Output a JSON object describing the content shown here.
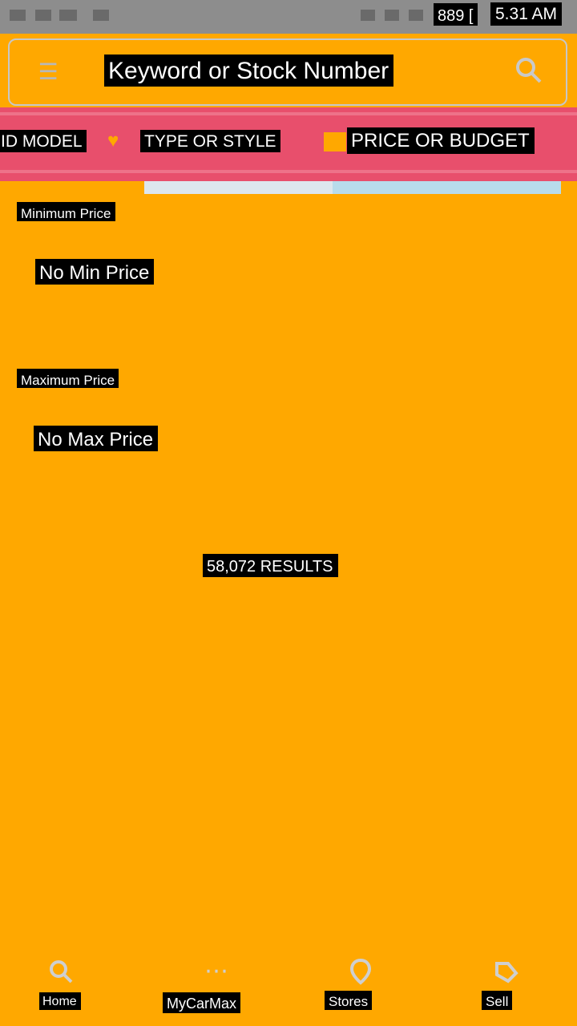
{
  "status_bar": {
    "count": "889 [",
    "time": "5.31 AM"
  },
  "search": {
    "placeholder": "Keyword or Stock Number"
  },
  "filters": {
    "tabs": [
      {
        "label": "ID MODEL"
      },
      {
        "label": "TYPE OR STYLE"
      },
      {
        "label": "PRICE OR BUDGET"
      }
    ],
    "selected": "PRICE OR BUDGET"
  },
  "price": {
    "min_label": "Minimum Price",
    "min_value": "No Min Price",
    "max_label": "Maximum Price",
    "max_value": "No Max Price"
  },
  "results": {
    "text": "58,072 RESULTS"
  },
  "bottom_nav": {
    "items": [
      {
        "label": "Home",
        "icon": "search-icon"
      },
      {
        "label": "MyCarMax",
        "icon": "car-icon"
      },
      {
        "label": "Stores",
        "icon": "location-pin-icon"
      },
      {
        "label": "Sell",
        "icon": "tag-icon"
      }
    ]
  },
  "colors": {
    "background": "#FFA800",
    "filter_bar": "#E84F6C",
    "status_bar": "#8D8D8D"
  }
}
